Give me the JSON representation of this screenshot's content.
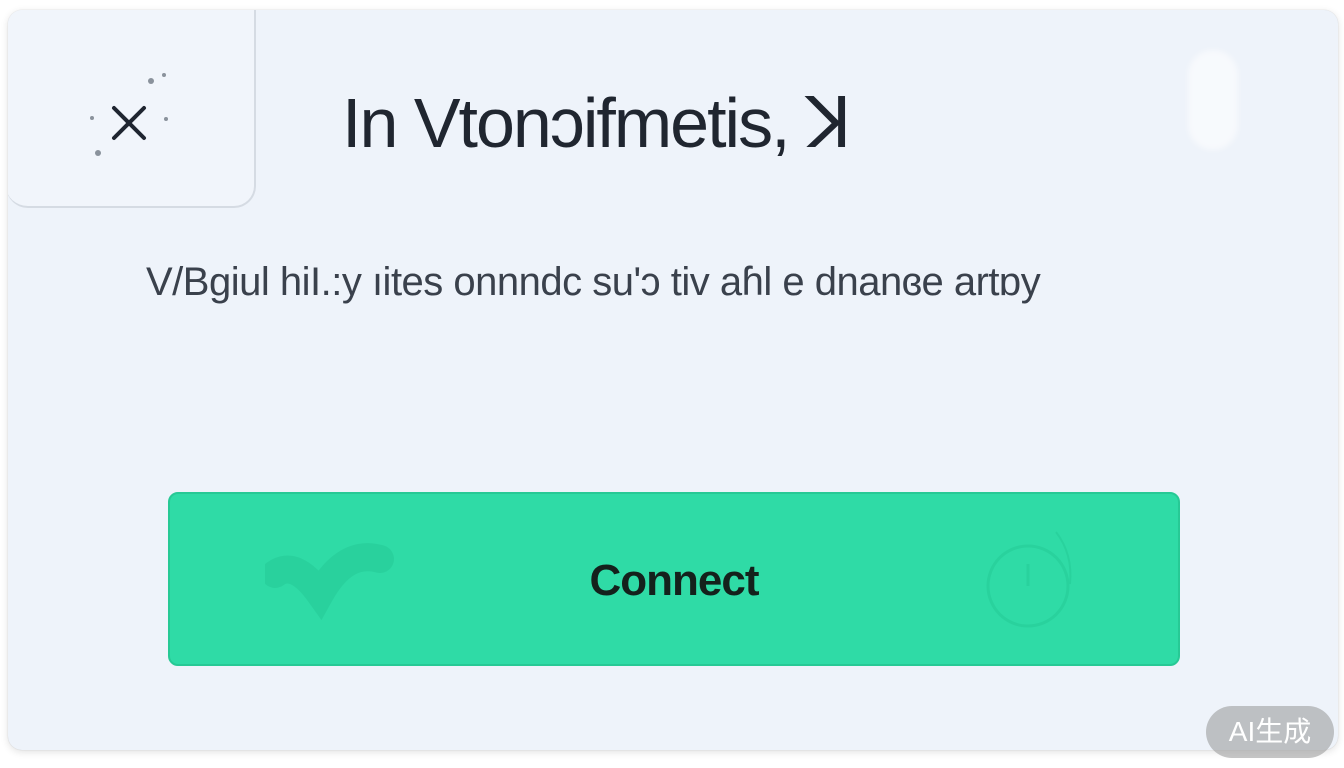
{
  "dialog": {
    "title": "In Vtonↄifmetis, ꓘ",
    "subtitle": "V/Bgiul hiI.:y ıites onnndc su'ↄ tiv aɦl e dnanɞe artɒy",
    "close_icon": "close-icon",
    "connect_label": "Connect"
  },
  "watermark": "AI生成",
  "colors": {
    "accent": "#2fdba6",
    "background": "#eef3fa",
    "text": "#202630"
  }
}
